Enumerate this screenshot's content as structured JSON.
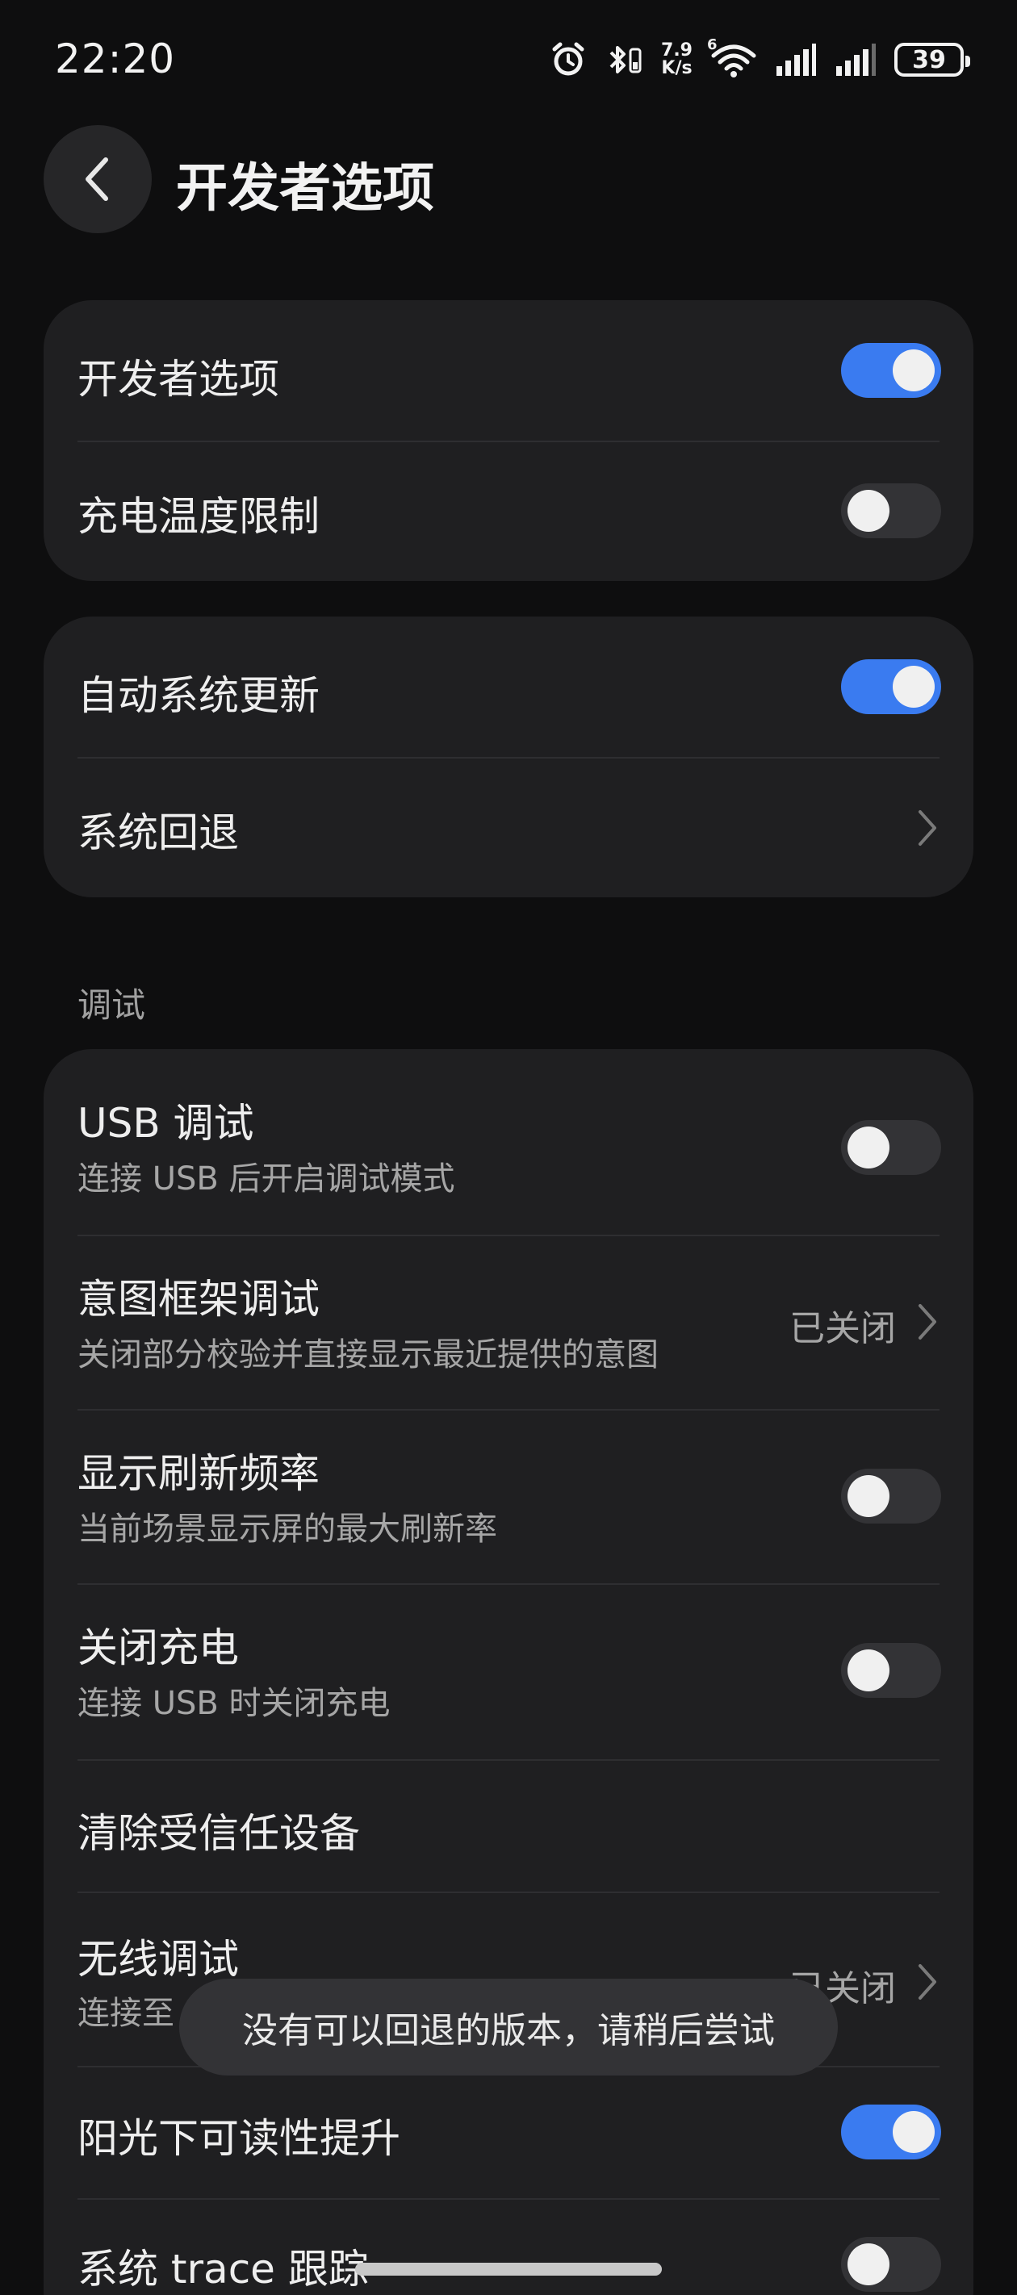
{
  "status_bar": {
    "time": "22:20",
    "net_speed_value": "7.9",
    "net_speed_unit": "K/s",
    "wifi_label": "6",
    "battery_level": "39"
  },
  "header": {
    "title": "开发者选项"
  },
  "card1": {
    "developer_options": {
      "label": "开发者选项",
      "enabled": true
    },
    "charge_temp_limit": {
      "label": "充电温度限制",
      "enabled": false
    }
  },
  "card2": {
    "auto_system_update": {
      "label": "自动系统更新",
      "enabled": true
    },
    "system_rollback": {
      "label": "系统回退"
    }
  },
  "section_debug": {
    "label": "调试"
  },
  "card3": {
    "usb_debugging": {
      "label": "USB 调试",
      "sub": "连接 USB 后开启调试模式",
      "enabled": false
    },
    "intent_framework_debug": {
      "label": "意图框架调试",
      "sub": "关闭部分校验并直接显示最近提供的意图",
      "value": "已关闭"
    },
    "show_refresh_rate": {
      "label": "显示刷新频率",
      "sub": "当前场景显示屏的最大刷新率",
      "enabled": false
    },
    "disable_charging": {
      "label": "关闭充电",
      "sub": "连接 USB 时关闭充电",
      "enabled": false
    },
    "clear_trusted_devices": {
      "label": "清除受信任设备"
    },
    "wireless_debugging": {
      "label": "无线调试",
      "sub": "连接至",
      "value": "已关闭"
    },
    "sunlight_readability": {
      "label": "阳光下可读性提升",
      "enabled": true
    },
    "system_trace": {
      "label": "系统 trace 跟踪",
      "enabled": false
    }
  },
  "toast": {
    "message": "没有可以回退的版本，请稍后尝试"
  },
  "colors": {
    "background": "#0e0e0f",
    "card": "#1f1f21",
    "accent": "#3a7bf0"
  }
}
